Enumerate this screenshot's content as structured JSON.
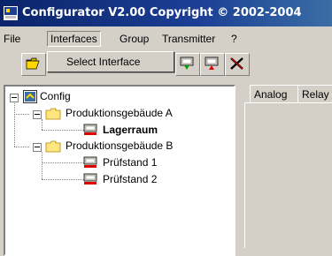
{
  "window": {
    "title": "Configurator  V2.00 Copyright © 2002-2004"
  },
  "menubar": {
    "items": [
      "File",
      "Interfaces",
      "Group",
      "Transmitter",
      "?"
    ]
  },
  "dropdown": {
    "item": "Select Interface"
  },
  "tree": {
    "root": "Config",
    "group_a": "Produktionsgebäude A",
    "group_a_child": "Lagerraum",
    "group_b": "Produktionsgebäude B",
    "group_b_child1": "Prüfstand 1",
    "group_b_child2": "Prüfstand 2"
  },
  "tabs": {
    "analog": "Analog",
    "relay": "Relay"
  }
}
